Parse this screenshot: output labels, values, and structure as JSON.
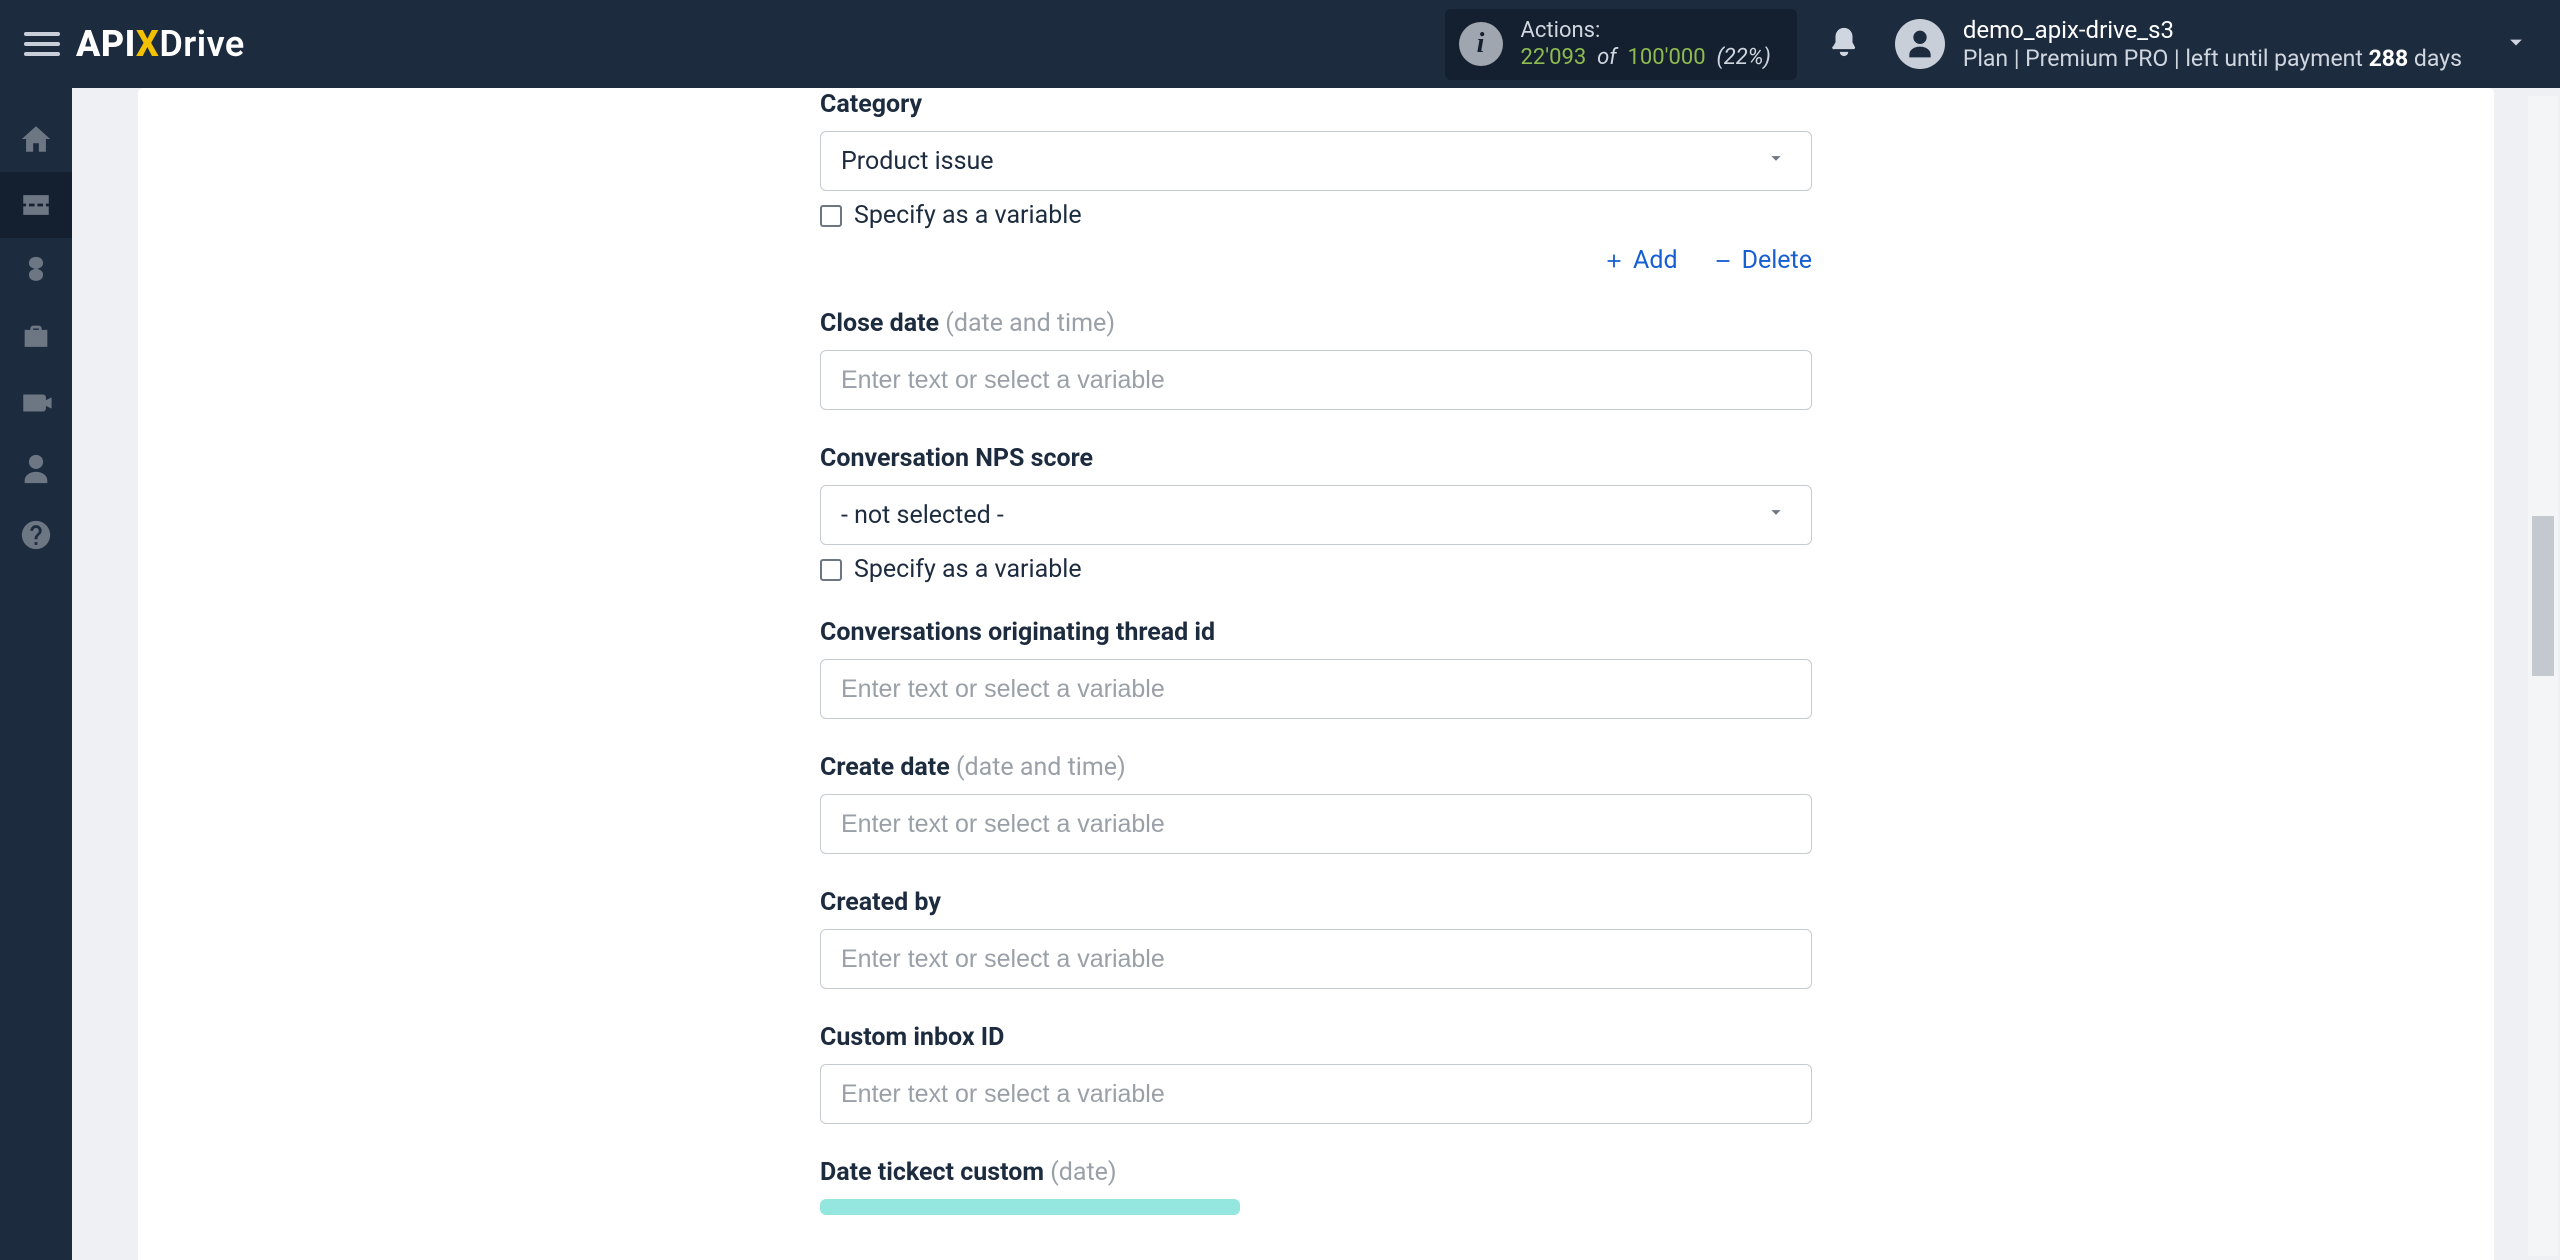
{
  "header": {
    "brand_api": "API",
    "brand_x": "X",
    "brand_drive": "Drive",
    "actions_label": "Actions:",
    "actions_used": "22'093",
    "actions_of": "of",
    "actions_total": "100'000",
    "actions_pct": "(22%)",
    "username": "demo_apix-drive_s3",
    "plan_prefix": "Plan |",
    "plan_name": "Premium PRO",
    "plan_mid": "| left until payment",
    "plan_days_num": "288",
    "plan_days_suffix": "days"
  },
  "form": {
    "category": {
      "label": "Category",
      "value": "Product issue",
      "specify_label": "Specify as a variable",
      "add_label": "Add",
      "delete_label": "Delete"
    },
    "close_date": {
      "label": "Close date",
      "hint": "(date and time)",
      "placeholder": "Enter text or select a variable"
    },
    "nps": {
      "label": "Conversation NPS score",
      "value": "- not selected -",
      "specify_label": "Specify as a variable"
    },
    "thread_id": {
      "label": "Conversations originating thread id",
      "placeholder": "Enter text or select a variable"
    },
    "create_date": {
      "label": "Create date",
      "hint": "(date and time)",
      "placeholder": "Enter text or select a variable"
    },
    "created_by": {
      "label": "Created by",
      "placeholder": "Enter text or select a variable"
    },
    "custom_inbox": {
      "label": "Custom inbox ID",
      "placeholder": "Enter text or select a variable"
    },
    "date_ticket_custom": {
      "label": "Date tickect custom",
      "hint": "(date)"
    }
  }
}
